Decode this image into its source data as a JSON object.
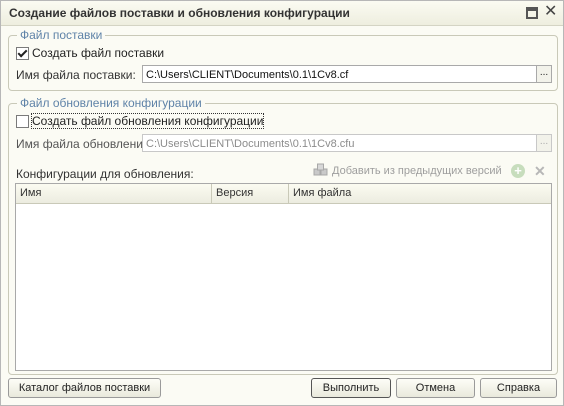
{
  "window": {
    "title": "Создание файлов поставки и обновления конфигурации",
    "maximize_icon": "maximize-icon",
    "close_icon": "close-icon",
    "close_glyph": "✕"
  },
  "supply_group": {
    "legend": "Файл поставки",
    "create_checkbox_label": "Создать файл поставки",
    "create_checked": true,
    "filename_label": "Имя файла поставки:",
    "filename_value": "C:\\Users\\CLIENT\\Documents\\0.1\\1Cv8.cf",
    "browse_label": "..."
  },
  "update_group": {
    "legend": "Файл обновления конфигурации",
    "create_checkbox_label": "Создать файл обновления конфигурации",
    "create_checked": false,
    "filename_label": "Имя файла обновления:",
    "filename_value": "C:\\Users\\CLIENT\\Documents\\0.1\\1Cv8.cfu",
    "browse_label": "...",
    "configs_label": "Конфигурации для обновления:",
    "add_from_prev_label": "Добавить из предыдущих версий",
    "add_icon": "add-icon",
    "delete_icon": "delete-icon",
    "table_columns": [
      "Имя",
      "Версия",
      "Имя файла"
    ]
  },
  "footer": {
    "catalog_button": "Каталог файлов поставки",
    "execute_button": "Выполнить",
    "cancel_button": "Отмена",
    "help_button": "Справка"
  }
}
